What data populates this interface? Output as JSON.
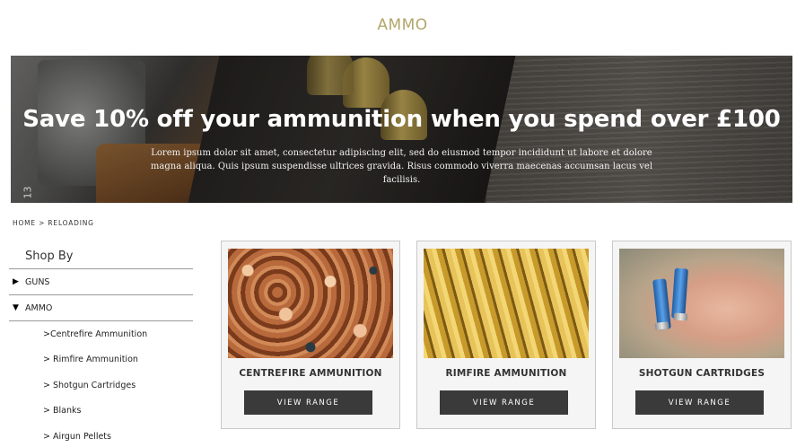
{
  "page": {
    "title": "AMMO"
  },
  "banner": {
    "headline": "Save 10% off your ammunition when you spend over £100",
    "body": "Lorem ipsum dolor sit amet, consectetur adipiscing elit, sed do eiusmod tempor incididunt ut labore et dolore magna aliqua. Quis ipsum suspendisse ultrices gravida. Risus commodo viverra maecenas accumsan lacus vel facilisis.",
    "mark": "13"
  },
  "breadcrumb": {
    "text": "HOME > RELOADING"
  },
  "sidebar": {
    "heading": "Shop By",
    "categories": [
      {
        "label": "GUNS",
        "state": "collapsed"
      },
      {
        "label": "AMMO",
        "state": "expanded"
      }
    ],
    "ammo_items": [
      ">Centrefire Ammunition",
      "> Rimfire Ammunition",
      "> Shotgun Cartridges",
      "> Blanks",
      "> Airgun Pellets"
    ]
  },
  "cards": [
    {
      "title": "CENTREFIRE AMMUNITION",
      "button": "VIEW RANGE",
      "image": "copper-bullets"
    },
    {
      "title": "RIMFIRE AMMUNITION",
      "button": "VIEW RANGE",
      "image": "brass-bullets"
    },
    {
      "title": "SHOTGUN CARTRIDGES",
      "button": "VIEW RANGE",
      "image": "hand-holding-cartridges"
    }
  ],
  "colors": {
    "title_accent": "#b3a56a",
    "button_bg": "#3a3a3a",
    "card_bg": "#f5f5f5"
  }
}
